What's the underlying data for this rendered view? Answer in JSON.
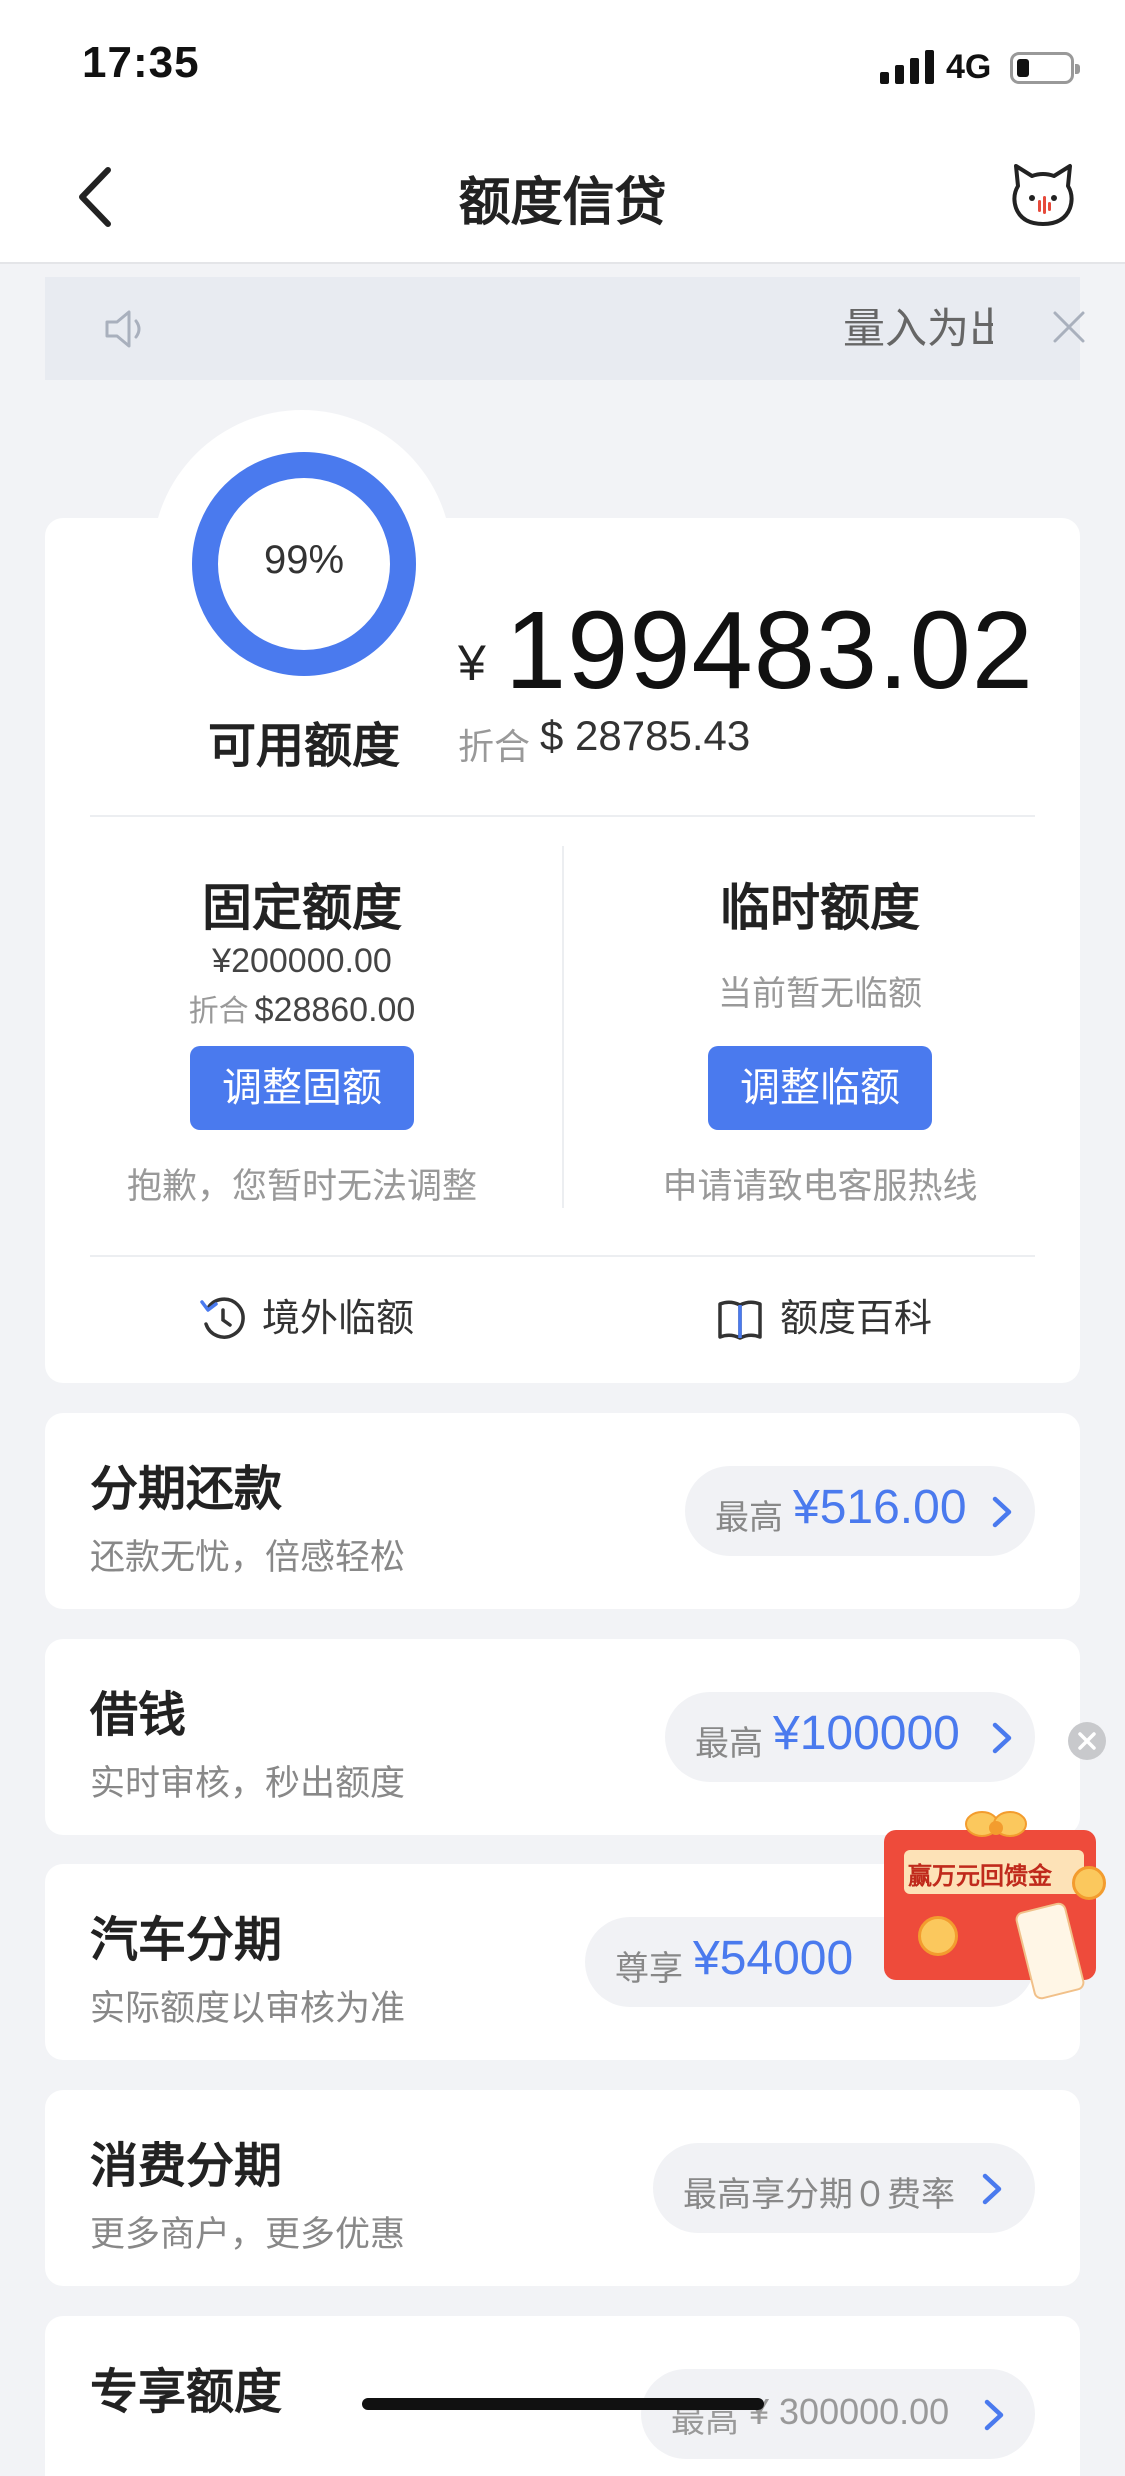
{
  "status_bar": {
    "time": "17:35",
    "network": "4G"
  },
  "header": {
    "title": "额度信贷"
  },
  "notice": {
    "text": "量入为出"
  },
  "credit": {
    "percent": "99%",
    "available_label": "可用额度",
    "currency_symbol": "¥",
    "available_amount": "199483.02",
    "converted_label": "折合",
    "converted_value": "$ 28785.43"
  },
  "fixed_limit": {
    "title": "固定额度",
    "amount": "¥200000.00",
    "converted_label": "折合",
    "converted_value": "$28860.00",
    "button": "调整固额",
    "note": "抱歉，您暂时无法调整"
  },
  "temp_limit": {
    "title": "临时额度",
    "status": "当前暂无临额",
    "button": "调整临额",
    "note": "申请请致电客服热线"
  },
  "links": {
    "overseas": "境外临额",
    "wiki": "额度百科"
  },
  "products": [
    {
      "title": "分期还款",
      "subtitle": "还款无忧，倍感轻松",
      "pill_label": "最高",
      "pill_value": "¥516.00"
    },
    {
      "title": "借钱",
      "subtitle": "实时审核，秒出额度",
      "pill_label": "最高",
      "pill_value": "¥100000"
    },
    {
      "title": "汽车分期",
      "subtitle": "实际额度以审核为准",
      "pill_label": "尊享",
      "pill_value": "¥54000"
    },
    {
      "title": "消费分期",
      "subtitle": "更多商户，更多优惠",
      "pill_label": "最高享分期０费率",
      "pill_value": ""
    },
    {
      "title": "专享额度",
      "subtitle": "",
      "pill_label": "最高",
      "pill_value": "¥ 300000.00"
    }
  ],
  "promo": {
    "text": "赢万元回馈金"
  },
  "colors": {
    "accent": "#4a7aee",
    "background": "#f2f3f6"
  }
}
